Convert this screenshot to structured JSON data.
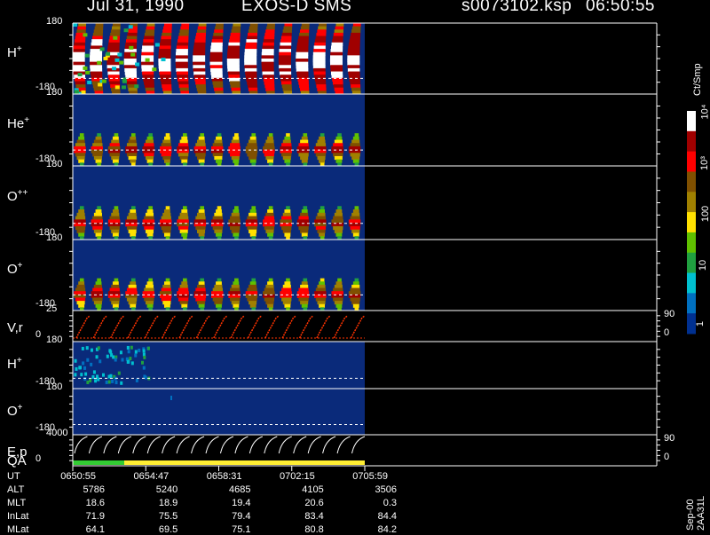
{
  "header": {
    "date": "Jul 31, 1990",
    "instrument": "EXOS-D SMS",
    "file": "s0073102.ksp",
    "time": "06:50:55"
  },
  "colors": {
    "background": "#000000",
    "panel_bg": "#0a2a7a",
    "lines": "#ffffff",
    "vr_trace": "#ff3300",
    "qa_green": "#33cc33",
    "qa_yellow": "#ffee33"
  },
  "colorbar": {
    "unit_label": "Ct/Smp",
    "tick_labels": [
      "10⁴",
      "10³",
      "100",
      "10",
      "1"
    ],
    "stops": [
      "#ffffff",
      "#a00000",
      "#ff0000",
      "#805000",
      "#a08000",
      "#ffe000",
      "#60c000",
      "#20a040",
      "#00c0d0",
      "#0070c0",
      "#003090"
    ]
  },
  "footer": {
    "row_labels": [
      "UT",
      "ALT",
      "MLT",
      "InLat",
      "MLat"
    ],
    "columns": [
      [
        "0650:55",
        "5786",
        "18.6",
        "71.9",
        "64.1"
      ],
      [
        "0654:47",
        "5240",
        "18.9",
        "75.5",
        "69.5"
      ],
      [
        "0658:31",
        "4685",
        "19.4",
        "79.4",
        "75.1"
      ],
      [
        "0702:15",
        "4105",
        "20.6",
        "83.4",
        "80.8"
      ],
      [
        "0705:59",
        "3506",
        "0.3",
        "84.4",
        "84.2"
      ]
    ]
  },
  "side_label": "Sep-00 2AA31L",
  "chart_data": {
    "type": "heatmap",
    "title": "Jul 31, 1990 EXOS-D SMS",
    "x_tick_labels": [
      "0650:55",
      "0654:47",
      "0658:31",
      "0702:15",
      "0705:59"
    ],
    "data_fraction_of_axis": 0.5,
    "scan_count": 17,
    "panels": [
      {
        "label": "H",
        "sup": "+",
        "ylim": [
          -180,
          180
        ],
        "tick_labels": [
          "180",
          "-180"
        ],
        "ref_line": "-150",
        "pattern": "H"
      },
      {
        "label": "He",
        "sup": "+",
        "ylim": [
          -180,
          180
        ],
        "tick_labels": [
          "180",
          "-180"
        ],
        "ref_line": "-150",
        "pattern": "blob"
      },
      {
        "label": "O",
        "sup": "++",
        "ylim": [
          -180,
          180
        ],
        "tick_labels": [
          "180",
          "-180"
        ],
        "ref_line": "-150",
        "pattern": "blob"
      },
      {
        "label": "O",
        "sup": "+",
        "ylim": [
          -180,
          180
        ],
        "tick_labels": [
          "180",
          "-180"
        ],
        "ref_line": "-150",
        "pattern": "blob"
      },
      {
        "label": "V,r",
        "sup": "",
        "ylim": [
          0,
          25
        ],
        "tick_labels": [
          "25",
          "0"
        ],
        "right_ticks": [
          "90",
          "0"
        ],
        "pattern": "vr"
      },
      {
        "label": "H",
        "sup": "+",
        "ylim": [
          -180,
          180
        ],
        "tick_labels": [
          "180",
          "-180"
        ],
        "ref_line": "-150",
        "pattern": "H2"
      },
      {
        "label": "O",
        "sup": "+",
        "ylim": [
          -180,
          180
        ],
        "tick_labels": [
          "180",
          "-180"
        ],
        "ref_line": "-150",
        "pattern": "O2"
      },
      {
        "label": "E,p",
        "sub_label": "QA",
        "sup": "",
        "ylim": [
          0,
          4000
        ],
        "tick_labels": [
          "4000",
          "0"
        ],
        "right_ticks": [
          "90",
          "0"
        ],
        "pattern": "ep"
      }
    ]
  }
}
